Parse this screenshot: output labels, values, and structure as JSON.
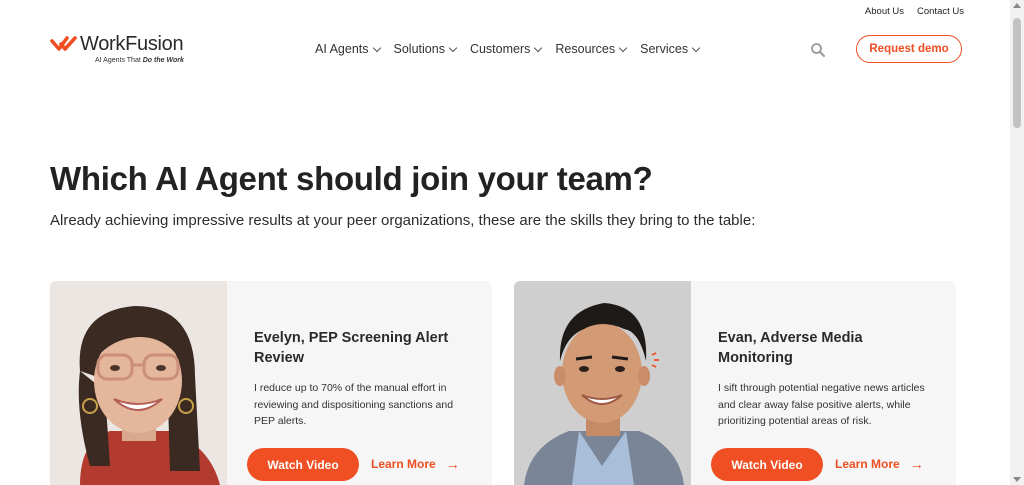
{
  "topbar": {
    "about": "About Us",
    "contact": "Contact Us"
  },
  "brand": {
    "name": "WorkFusion",
    "tagline_prefix": "AI Agents That ",
    "tagline_emph": "Do the Work",
    "accent": "#f04e23"
  },
  "nav": [
    "AI Agents",
    "Solutions",
    "Customers",
    "Resources",
    "Services"
  ],
  "header": {
    "search_icon": "search-icon",
    "cta": "Request demo"
  },
  "hero": {
    "title": "Which AI Agent should join your team?",
    "subtitle": "Already achieving impressive results at your peer organizations, these are the skills they bring to the table:"
  },
  "cards": [
    {
      "title": "Evelyn, PEP Screening Alert Review",
      "description": "I reduce up to 70% of the manual effort in reviewing and dispositioning sanctions and PEP alerts.",
      "watch_label": "Watch Video",
      "learn_label": "Learn More"
    },
    {
      "title": "Evan, Adverse Media Monitoring",
      "description": "I sift through potential negative news articles and clear away false positive alerts, while prioritizing potential areas of risk.",
      "watch_label": "Watch Video",
      "learn_label": "Learn More"
    }
  ]
}
